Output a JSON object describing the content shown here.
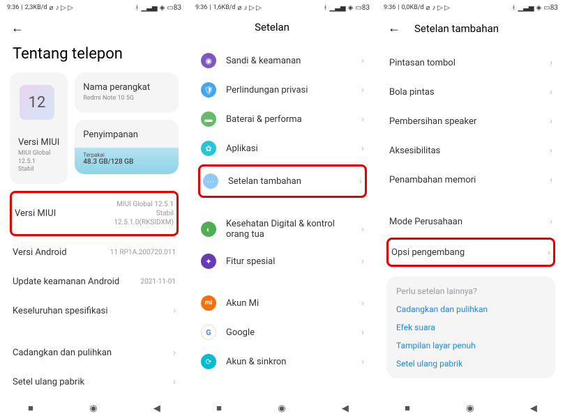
{
  "status": {
    "p1": {
      "time": "9:36",
      "data": "2,3KB/d",
      "right": "83"
    },
    "p2": {
      "time": "9:36",
      "data": "1,6KB/d",
      "right": "83"
    },
    "p3": {
      "time": "9:36",
      "data": "0,0KB/d",
      "right": "83"
    }
  },
  "panel1": {
    "title": "Tentang telepon",
    "miui_card": {
      "label": "Versi MIUI",
      "sub1": "MIUI Global",
      "sub2": "12.5.1",
      "sub3": "Stabil"
    },
    "device_card": {
      "label": "Nama perangkat",
      "value": "Redmi Note 10 5G"
    },
    "storage_card": {
      "label": "Penyimpanan",
      "used_label": "Terpakai",
      "value": "48.3 GB/128 GB"
    },
    "items": [
      {
        "label": "Versi MIUI",
        "v1": "MIUI Global 12.5.1",
        "v2": "Stabil",
        "v3": "12.5.1.0(RKSIDXM)"
      },
      {
        "label": "Versi Android",
        "value": "11 RP1A.200720.011"
      },
      {
        "label": "Update keamanan Android",
        "value": "2021-11-01"
      },
      {
        "label": "Keseluruhan spesifikasi"
      },
      {
        "label": "Cadangkan dan pulihkan"
      },
      {
        "label": "Setel ulang pabrik"
      }
    ]
  },
  "panel2": {
    "title": "Setelan",
    "items": [
      {
        "label": "Sandi & keamanan",
        "icon": "ic-purple",
        "glyph": "◉"
      },
      {
        "label": "Perlindungan privasi",
        "icon": "ic-blue",
        "glyph": "🛡"
      },
      {
        "label": "Baterai & performa",
        "icon": "ic-green",
        "glyph": "▬"
      },
      {
        "label": "Aplikasi",
        "icon": "ic-teal",
        "glyph": "✿"
      },
      {
        "label": "Setelan tambahan",
        "icon": "ic-lblue",
        "glyph": "⋯"
      },
      {
        "label": "Kesehatan Digital & kontrol orang tua",
        "icon": "ic-dgreen",
        "glyph": "◐"
      },
      {
        "label": "Fitur spesial",
        "icon": "ic-dpurple",
        "glyph": "✦"
      },
      {
        "label": "Akun Mi",
        "icon": "ic-miorange",
        "glyph": "mi"
      },
      {
        "label": "Google",
        "icon": "ic-red",
        "glyph": "G"
      },
      {
        "label": "Akun & sinkron",
        "icon": "ic-cyan",
        "glyph": "⟳"
      }
    ]
  },
  "panel3": {
    "title": "Setelan tambahan",
    "items": [
      {
        "label": "Pintasan tombol"
      },
      {
        "label": "Bola pintas"
      },
      {
        "label": "Pembersihan speaker"
      },
      {
        "label": "Aksesibilitas"
      },
      {
        "label": "Penambahan memori"
      },
      {
        "label": "Mode Perusahaan"
      },
      {
        "label": "Opsi pengembang"
      }
    ],
    "footer": {
      "title": "Perlu setelan lainnya?",
      "links": [
        "Cadangkan dan pulihkan",
        "Efek suara",
        "Tampilan layar penuh",
        "Setel ulang pabrik"
      ]
    }
  }
}
